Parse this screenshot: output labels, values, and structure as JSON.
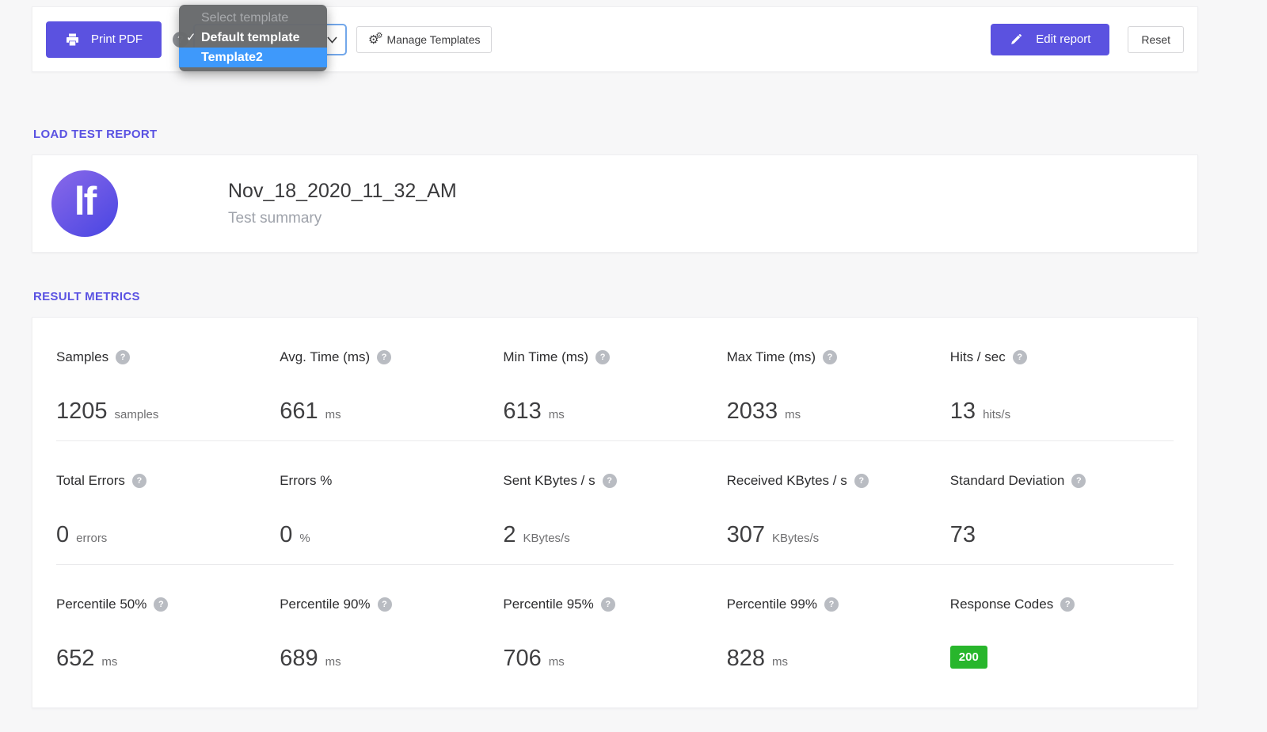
{
  "icons": {
    "help_glyph": "?",
    "gear_glyph": "⚙",
    "gear_small_glyph": "⚙",
    "check_glyph": "✓"
  },
  "toolbar": {
    "print_pdf_label": "Print PDF",
    "manage_templates_label": "Manage Templates",
    "edit_report_label": "Edit report",
    "reset_label": "Reset"
  },
  "template_dropdown": {
    "selected_value": "Default template",
    "options": [
      {
        "label": "Select template",
        "state": "disabled"
      },
      {
        "label": "Default template",
        "state": "selected"
      },
      {
        "label": "Template2",
        "state": "highlighted"
      }
    ],
    "highlight_color": "#3e99fb"
  },
  "sections": {
    "load_test_report": "LOAD TEST REPORT",
    "result_metrics": "RESULT METRICS"
  },
  "report_header": {
    "logo_text": "lf",
    "title": "Nov_18_2020_11_32_AM",
    "subtitle": "Test summary"
  },
  "metrics": {
    "rows": [
      {
        "cells": [
          {
            "label": "Samples",
            "value": "1205",
            "unit": "samples",
            "help": true
          },
          {
            "label": "Avg. Time (ms)",
            "value": "661",
            "unit": "ms",
            "help": true
          },
          {
            "label": "Min Time (ms)",
            "value": "613",
            "unit": "ms",
            "help": true
          },
          {
            "label": "Max Time (ms)",
            "value": "2033",
            "unit": "ms",
            "help": true
          },
          {
            "label": "Hits / sec",
            "value": "13",
            "unit": "hits/s",
            "help": true
          }
        ]
      },
      {
        "cells": [
          {
            "label": "Total Errors",
            "value": "0",
            "unit": "errors",
            "help": true
          },
          {
            "label": "Errors %",
            "value": "0",
            "unit": "%",
            "help": false
          },
          {
            "label": "Sent KBytes / s",
            "value": "2",
            "unit": "KBytes/s",
            "help": true
          },
          {
            "label": "Received KBytes / s",
            "value": "307",
            "unit": "KBytes/s",
            "help": true
          },
          {
            "label": "Standard Deviation",
            "value": "73",
            "unit": "",
            "help": true
          }
        ]
      },
      {
        "cells": [
          {
            "label": "Percentile 50%",
            "value": "652",
            "unit": "ms",
            "help": true
          },
          {
            "label": "Percentile 90%",
            "value": "689",
            "unit": "ms",
            "help": true
          },
          {
            "label": "Percentile 95%",
            "value": "706",
            "unit": "ms",
            "help": true
          },
          {
            "label": "Percentile 99%",
            "value": "828",
            "unit": "ms",
            "help": true
          },
          {
            "label": "Response Codes",
            "badge": "200",
            "help": true
          }
        ]
      }
    ]
  },
  "colors": {
    "accent_purple": "#5b52e0",
    "badge_green": "#28b62c",
    "dropdown_highlight": "#3e99fb",
    "select_focus_border": "#72a7ea"
  }
}
